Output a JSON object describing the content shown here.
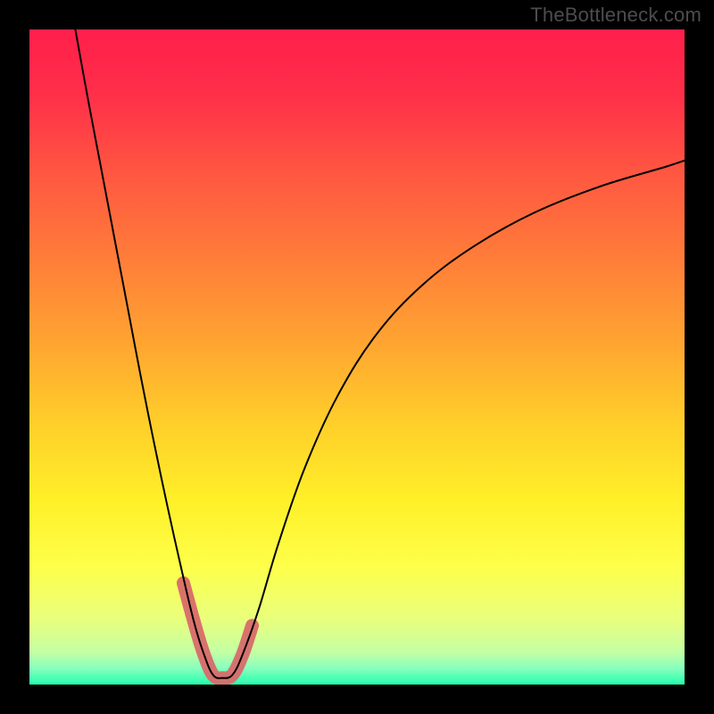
{
  "watermark": "TheBottleneck.com",
  "chart_data": {
    "type": "line",
    "title": "",
    "xlabel": "",
    "ylabel": "",
    "xlim": [
      0,
      100
    ],
    "ylim": [
      0,
      100
    ],
    "grid": false,
    "legend": false,
    "background_gradient": {
      "direction": "vertical",
      "stops": [
        {
          "offset": 0.0,
          "color": "#ff1f4b"
        },
        {
          "offset": 0.1,
          "color": "#ff2f49"
        },
        {
          "offset": 0.22,
          "color": "#ff5741"
        },
        {
          "offset": 0.35,
          "color": "#ff7d39"
        },
        {
          "offset": 0.48,
          "color": "#ffa531"
        },
        {
          "offset": 0.6,
          "color": "#ffce2a"
        },
        {
          "offset": 0.72,
          "color": "#fff028"
        },
        {
          "offset": 0.82,
          "color": "#fdff4a"
        },
        {
          "offset": 0.9,
          "color": "#e9ff7d"
        },
        {
          "offset": 0.95,
          "color": "#c4ffa3"
        },
        {
          "offset": 0.975,
          "color": "#88ffbe"
        },
        {
          "offset": 1.0,
          "color": "#26ffad"
        }
      ]
    },
    "series": [
      {
        "name": "bottleneck-curve",
        "color": "#000000",
        "stroke_width": 2,
        "x": [
          7.0,
          9.0,
          11.0,
          13.0,
          15.0,
          17.0,
          19.0,
          21.0,
          23.0,
          25.0,
          26.5,
          28.0,
          29.5,
          31.0,
          32.5,
          35.0,
          38.0,
          42.0,
          47.0,
          53.0,
          60.0,
          68.0,
          77.0,
          87.0,
          97.0,
          100.0
        ],
        "y": [
          100.0,
          89.0,
          78.5,
          68.0,
          57.5,
          47.0,
          37.0,
          27.5,
          18.5,
          10.0,
          5.0,
          1.5,
          1.0,
          1.5,
          4.5,
          11.5,
          21.5,
          33.0,
          44.0,
          53.5,
          61.0,
          67.0,
          72.0,
          76.0,
          79.0,
          80.0
        ]
      },
      {
        "name": "highlight-segment",
        "color": "#d86a6a",
        "stroke_width": 15,
        "linecap": "round",
        "x": [
          23.5,
          25.0,
          26.5,
          28.0,
          29.5,
          31.0,
          32.5,
          34.0
        ],
        "y": [
          15.5,
          10.0,
          5.0,
          1.5,
          1.0,
          1.5,
          4.5,
          9.0
        ]
      }
    ]
  }
}
